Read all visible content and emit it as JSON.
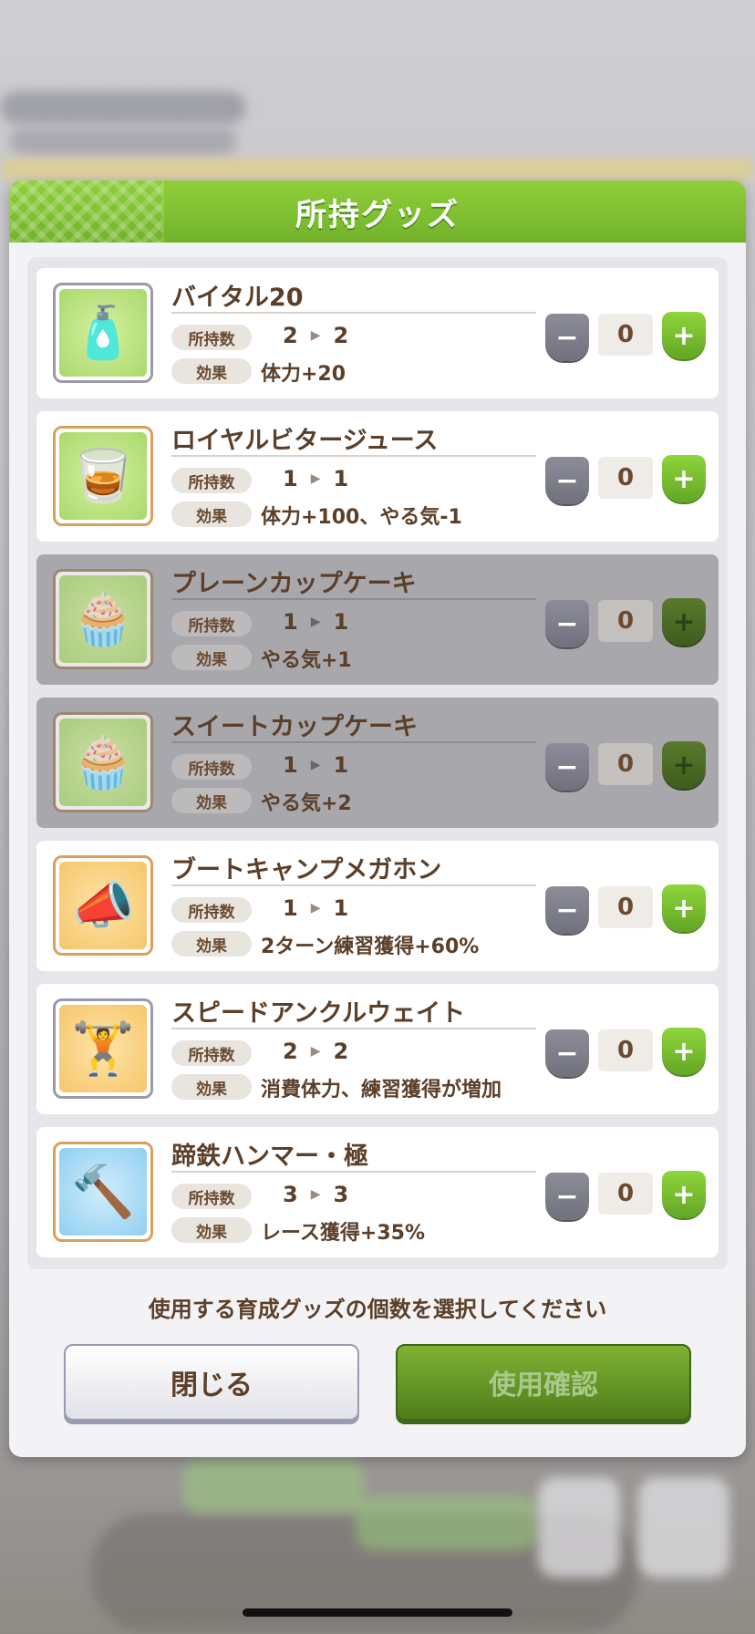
{
  "dialog": {
    "title": "所持グッズ",
    "instruction": "使用する育成グッズの個数を選択してください",
    "close_label": "閉じる",
    "confirm_label": "使用確認"
  },
  "labels": {
    "owned": "所持数",
    "effect": "効果",
    "minus": "−",
    "plus": "+"
  },
  "items": [
    {
      "name": "バイタル20",
      "owned_before": "2",
      "owned_after": "2",
      "effect": "体力+20",
      "count": "0",
      "icon": "energy-drink-icon",
      "enabled": true
    },
    {
      "name": "ロイヤルビタージュース",
      "owned_before": "1",
      "owned_after": "1",
      "effect": "体力+100、やる気-1",
      "count": "0",
      "icon": "green-juice-icon",
      "enabled": true
    },
    {
      "name": "プレーンカップケーキ",
      "owned_before": "1",
      "owned_after": "1",
      "effect": "やる気+1",
      "count": "0",
      "icon": "cupcake-icon",
      "enabled": false
    },
    {
      "name": "スイートカップケーキ",
      "owned_before": "1",
      "owned_after": "1",
      "effect": "やる気+2",
      "count": "0",
      "icon": "sweet-cupcake-icon",
      "enabled": false
    },
    {
      "name": "ブートキャンプメガホン",
      "owned_before": "1",
      "owned_after": "1",
      "effect": "2ターン練習獲得+60%",
      "count": "0",
      "icon": "megaphone-icon",
      "enabled": true
    },
    {
      "name": "スピードアンクルウェイト",
      "owned_before": "2",
      "owned_after": "2",
      "effect": "消費体力、練習獲得が増加",
      "count": "0",
      "icon": "ankle-weight-icon",
      "enabled": true
    },
    {
      "name": "蹄鉄ハンマー・極",
      "owned_before": "3",
      "owned_after": "3",
      "effect": "レース獲得+35%",
      "count": "0",
      "icon": "horseshoe-hammer-icon",
      "enabled": true
    }
  ]
}
